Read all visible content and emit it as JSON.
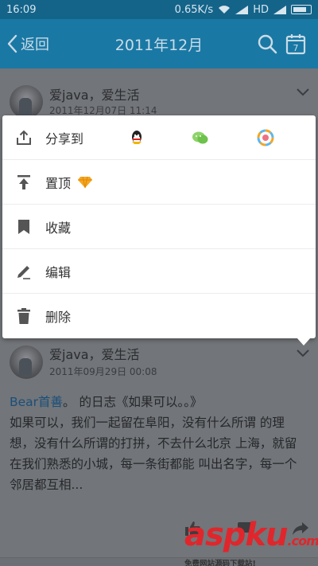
{
  "status_bar": {
    "time": "16:09",
    "net_speed": "0.65K/s",
    "network": "HD"
  },
  "app_bar": {
    "back_label": "返回",
    "title": "2011年12月",
    "calendar_day": "7"
  },
  "posts": [
    {
      "author": "爱java，爱生活",
      "time": "2011年12月07日 11:14"
    },
    {
      "author": "爱java，爱生活",
      "time": "2011年09月29日 00:08",
      "shared_user": "Bear首善",
      "shared_suffix": "。 的日志《如果可以。。》",
      "text": "如果可以，我们一起留在阜阳，没有什么所谓 的理想，没有什么所谓的打拼，不去什么北京 上海，就留在我们熟悉的小城，每一条街都能 叫出名字，每一个邻居都互相..."
    }
  ],
  "menu": {
    "items": [
      {
        "label": "分享到",
        "icon": "share-icon"
      },
      {
        "label": "置顶",
        "icon": "pin-top-icon"
      },
      {
        "label": "收藏",
        "icon": "bookmark-icon"
      },
      {
        "label": "编辑",
        "icon": "edit-icon"
      },
      {
        "label": "删除",
        "icon": "trash-icon"
      }
    ],
    "share_targets": [
      "qq-icon",
      "wechat-icon",
      "moments-icon"
    ]
  },
  "watermark": {
    "logo": "aspku",
    "logo_tld": ".com",
    "subtitle": "免费网站源码下载站!"
  },
  "colors": {
    "app_bar": "#1a78a5",
    "status_bar": "#14648a",
    "link": "#1a4f7a",
    "watermark": "#e0262c"
  }
}
